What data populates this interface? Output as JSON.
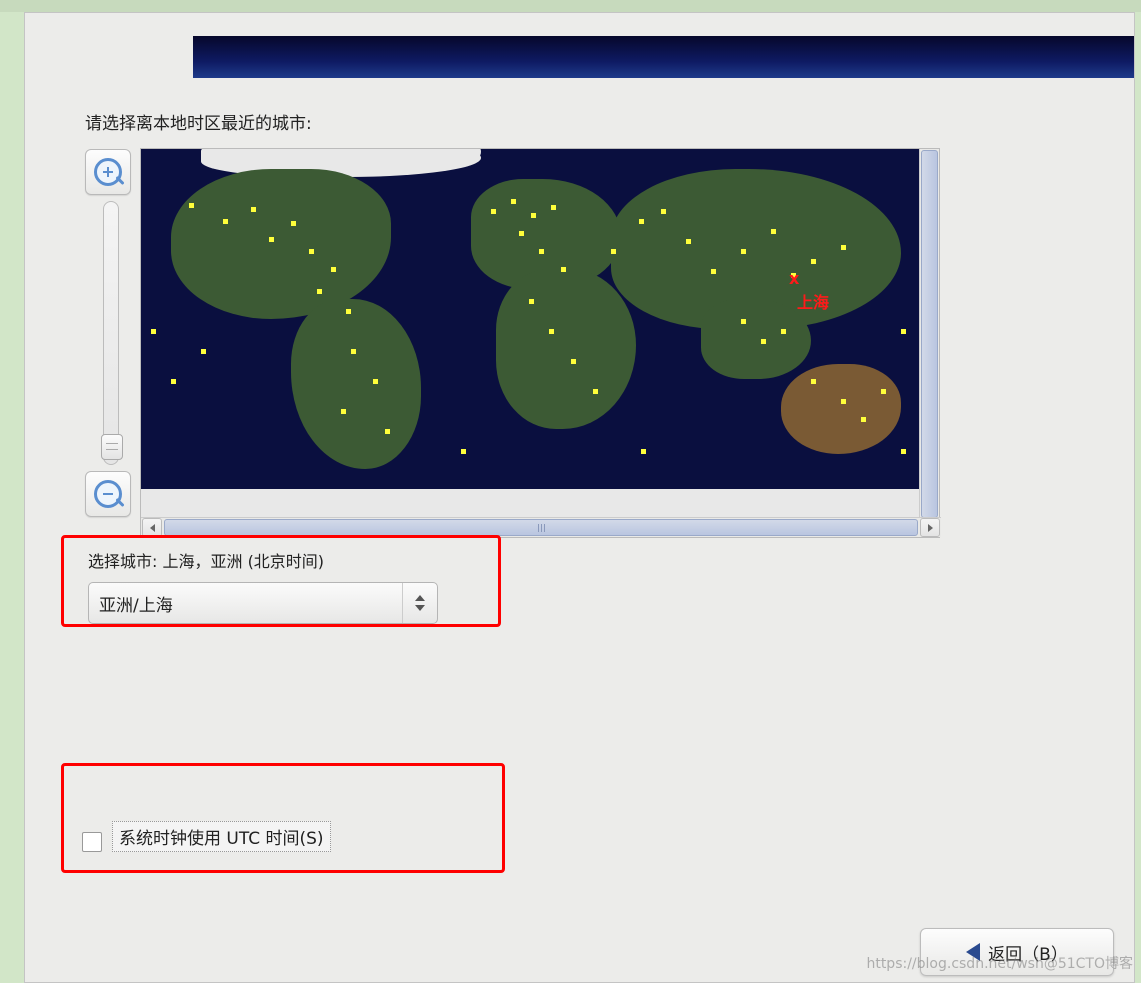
{
  "prompt": "请选择离本地时区最近的城市:",
  "selected_city_label": "选择城市: 上海，亚洲 (北京时间)",
  "timezone_combo_value": "亚洲/上海",
  "map_marker": {
    "symbol": "x",
    "label": "上海"
  },
  "utc_checkbox": {
    "label": "系统时钟使用 UTC 时间(S)",
    "checked": false
  },
  "buttons": {
    "back": "返回（B）"
  },
  "watermark": "https://blog.csdn.net/wsh@51CTO博客"
}
